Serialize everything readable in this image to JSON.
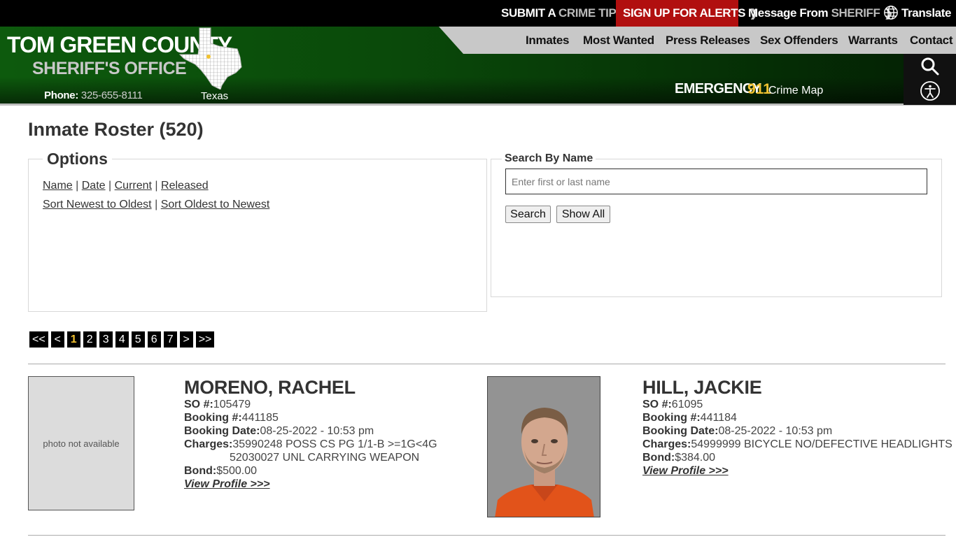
{
  "topbar": {
    "tip_strong": "SUBMIT A",
    "tip_light": "CRIME TIP",
    "alerts": "SIGN UP FOR ALERTS",
    "msg_strong": "Message From",
    "msg_light": "SHERIFF",
    "translate": "Translate"
  },
  "header": {
    "brand_line1": "TOM GREEN COUNTY",
    "brand_line2": "SHERIFF'S OFFICE",
    "phone_label": "Phone:",
    "phone_number": "325-655-8111",
    "state_label": "Texas",
    "emergency_label": "EMERGENCY",
    "emergency_number": "911",
    "crime_map": "Crime Map"
  },
  "nav": {
    "items": [
      "Inmates",
      "Most Wanted",
      "Press Releases",
      "Sex Offenders",
      "Warrants",
      "Contact"
    ]
  },
  "page": {
    "title": "Inmate Roster (520)"
  },
  "options": {
    "legend": "Options",
    "links_row1": [
      "Name",
      "Date",
      "Current",
      "Released"
    ],
    "links_row2": [
      "Sort Newest to Oldest",
      "Sort Oldest to Newest"
    ],
    "separator": "|"
  },
  "search": {
    "legend": "Search By Name",
    "placeholder": "Enter first or last name",
    "value": "",
    "search_button": "Search",
    "show_all_button": "Show All"
  },
  "pagination": {
    "first": "<<",
    "prev": "<",
    "pages": [
      "1",
      "2",
      "3",
      "4",
      "5",
      "6",
      "7"
    ],
    "current": "1",
    "next": ">",
    "last": ">>"
  },
  "inmates": [
    {
      "photo_text": "photo not available",
      "name": "MORENO, RACHEL",
      "so_label": "SO #:",
      "so": "105479",
      "booking_label": "Booking #:",
      "booking": "441185",
      "date_label": "Booking Date:",
      "date": "08-25-2022 - 10:53 pm",
      "charges_label": "Charges:",
      "charges": [
        "35990248 POSS CS PG 1/1-B >=1G<4G",
        "52030027 UNL CARRYING WEAPON"
      ],
      "bond_label": "Bond:",
      "bond": "$500.00",
      "profile_link": "View Profile >>>"
    },
    {
      "photo_text": "",
      "name": "HILL, JACKIE",
      "so_label": "SO #:",
      "so": "61095",
      "booking_label": "Booking #:",
      "booking": "441184",
      "date_label": "Booking Date:",
      "date": "08-25-2022 - 10:53 pm",
      "charges_label": "Charges:",
      "charges": [
        "54999999 BICYCLE NO/DEFECTIVE HEADLIGHTS"
      ],
      "bond_label": "Bond:",
      "bond": "$384.00",
      "profile_link": "View Profile >>>"
    }
  ],
  "colors": {
    "header_green": "#0a4a0a",
    "alert_red": "#b10f0f",
    "accent_yellow": "#f2c230",
    "nav_grey": "#c8c8c8"
  }
}
